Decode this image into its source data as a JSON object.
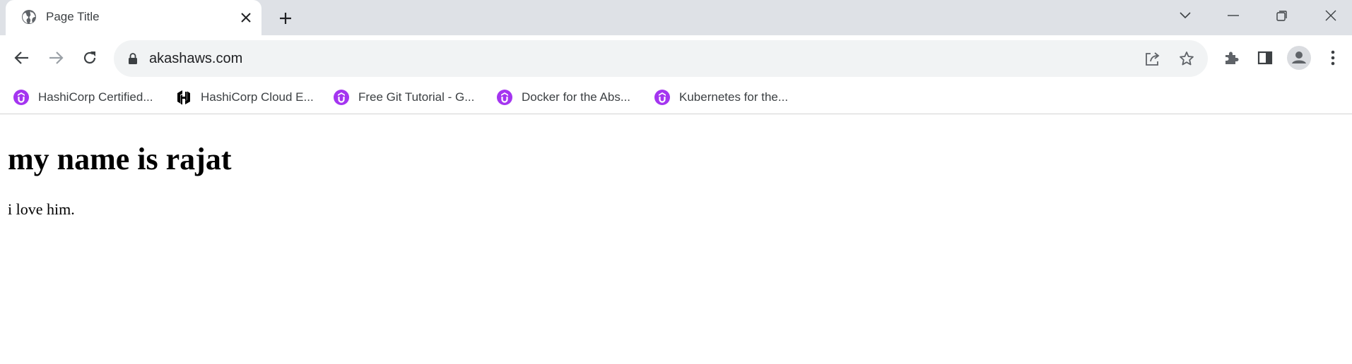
{
  "browser": {
    "tab": {
      "title": "Page Title",
      "favicon": "globe-icon"
    },
    "address_bar": {
      "url": "akashaws.com"
    },
    "bookmarks": [
      {
        "label": "HashiCorp Certified...",
        "icon": "udemy-icon"
      },
      {
        "label": "HashiCorp Cloud E...",
        "icon": "hashicorp-icon"
      },
      {
        "label": "Free Git Tutorial - G...",
        "icon": "udemy-icon"
      },
      {
        "label": "Docker for the Abs...",
        "icon": "udemy-icon"
      },
      {
        "label": "Kubernetes for the...",
        "icon": "udemy-icon"
      }
    ],
    "colors": {
      "tabstrip": "#dee1e6",
      "omnibox": "#f1f3f4",
      "icon": "#5f6368",
      "udemy_purple": "#a435f0"
    }
  },
  "page": {
    "heading": "my name is rajat",
    "paragraph": "i love him."
  }
}
